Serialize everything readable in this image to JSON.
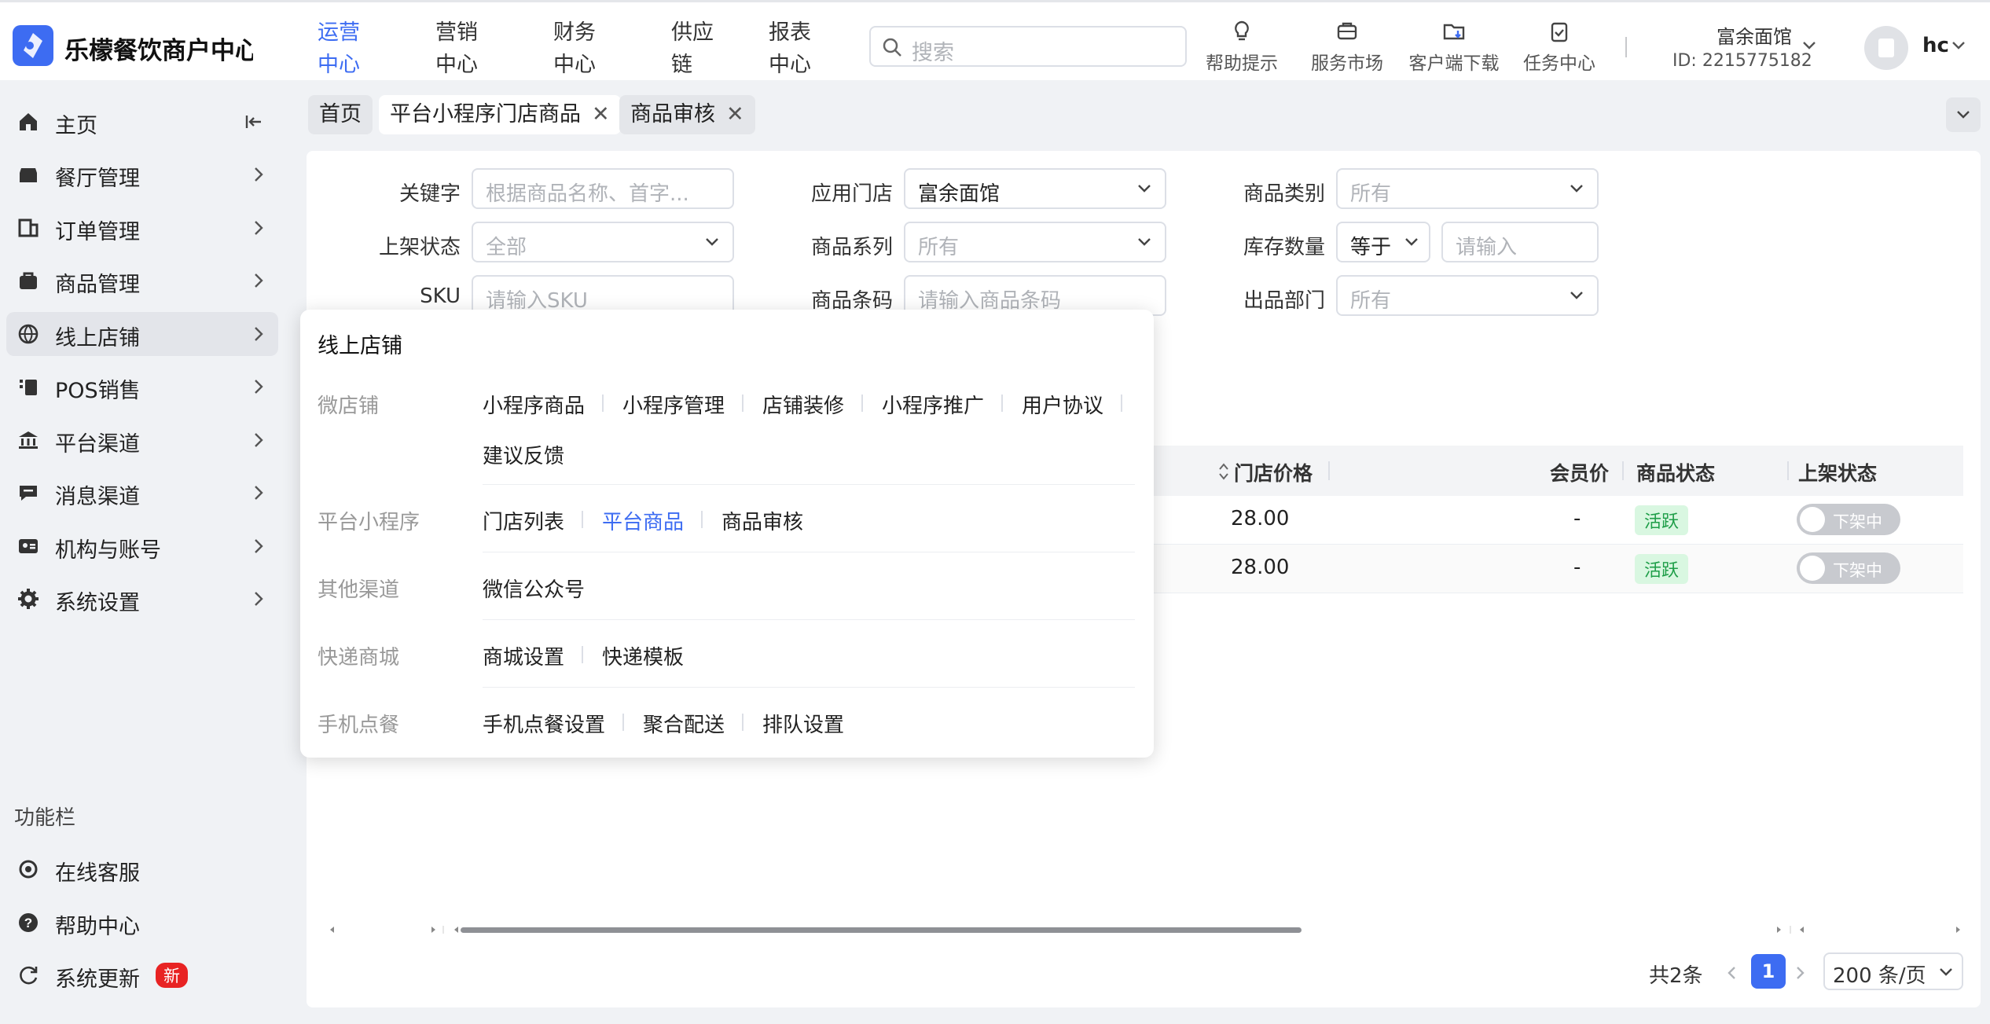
{
  "app": {
    "title": "乐檬餐饮商户中心",
    "accent": "#3d6cf2"
  },
  "topnav": [
    "运营中心",
    "营销中心",
    "财务中心",
    "供应链",
    "报表中心"
  ],
  "search": {
    "placeholder": "搜索"
  },
  "header_actions": [
    "帮助提示",
    "服务市场",
    "客户端下载",
    "任务中心"
  ],
  "store": {
    "name": "富余面馆",
    "id": "ID: 2215775182"
  },
  "user": {
    "name": "hc"
  },
  "sidebar": {
    "items": [
      "主页",
      "餐厅管理",
      "订单管理",
      "商品管理",
      "线上店铺",
      "POS销售",
      "平台渠道",
      "消息渠道",
      "机构与账号",
      "系统设置"
    ],
    "section": "功能栏",
    "func_items": [
      "在线客服",
      "帮助中心",
      "系统更新"
    ],
    "new_badge": "新"
  },
  "tabs": [
    "首页",
    "平台小程序门店商品",
    "商品审核"
  ],
  "filters": {
    "keyword": {
      "label": "关键字",
      "placeholder": "根据商品名称、首字..."
    },
    "store": {
      "label": "应用门店",
      "value": "富余面馆"
    },
    "category": {
      "label": "商品类别",
      "placeholder": "所有"
    },
    "shelf": {
      "label": "上架状态",
      "placeholder": "全部"
    },
    "series": {
      "label": "商品系列",
      "placeholder": "所有"
    },
    "stock": {
      "label": "库存数量",
      "op": "等于",
      "placeholder": "请输入"
    },
    "sku": {
      "label": "SKU",
      "placeholder": "请输入SKU"
    },
    "barcode": {
      "label": "商品条码",
      "placeholder": "请输入商品条码"
    },
    "dept": {
      "label": "出品部门",
      "placeholder": "所有"
    }
  },
  "table": {
    "columns": [
      "门店价格",
      "会员价",
      "商品状态",
      "上架状态"
    ],
    "rows": [
      {
        "price": "28.00",
        "member_price": "-",
        "status": "活跃",
        "shelf": "下架中"
      },
      {
        "price": "28.00",
        "member_price": "-",
        "status": "活跃",
        "shelf": "下架中"
      }
    ]
  },
  "pagination": {
    "total": "共2条",
    "current": "1",
    "size": "200 条/页"
  },
  "popup": {
    "title": "线上店铺",
    "groups": [
      {
        "name": "微店铺",
        "links": [
          "小程序商品",
          "小程序管理",
          "店铺装修",
          "小程序推广",
          "用户协议",
          "建议反馈"
        ]
      },
      {
        "name": "平台小程序",
        "links": [
          "门店列表",
          "平台商品",
          "商品审核"
        ]
      },
      {
        "name": "其他渠道",
        "links": [
          "微信公众号"
        ]
      },
      {
        "name": "快递商城",
        "links": [
          "商城设置",
          "快递模板"
        ]
      },
      {
        "name": "手机点餐",
        "links": [
          "手机点餐设置",
          "聚合配送",
          "排队设置"
        ]
      }
    ]
  },
  "icons": [
    "logo-icon",
    "search-icon",
    "bulb-icon",
    "briefcase-icon",
    "folder-download-icon",
    "clipboard-icon",
    "chevron-down-icon",
    "home-icon",
    "collapse-icon",
    "chevron-right-icon",
    "close-icon"
  ]
}
